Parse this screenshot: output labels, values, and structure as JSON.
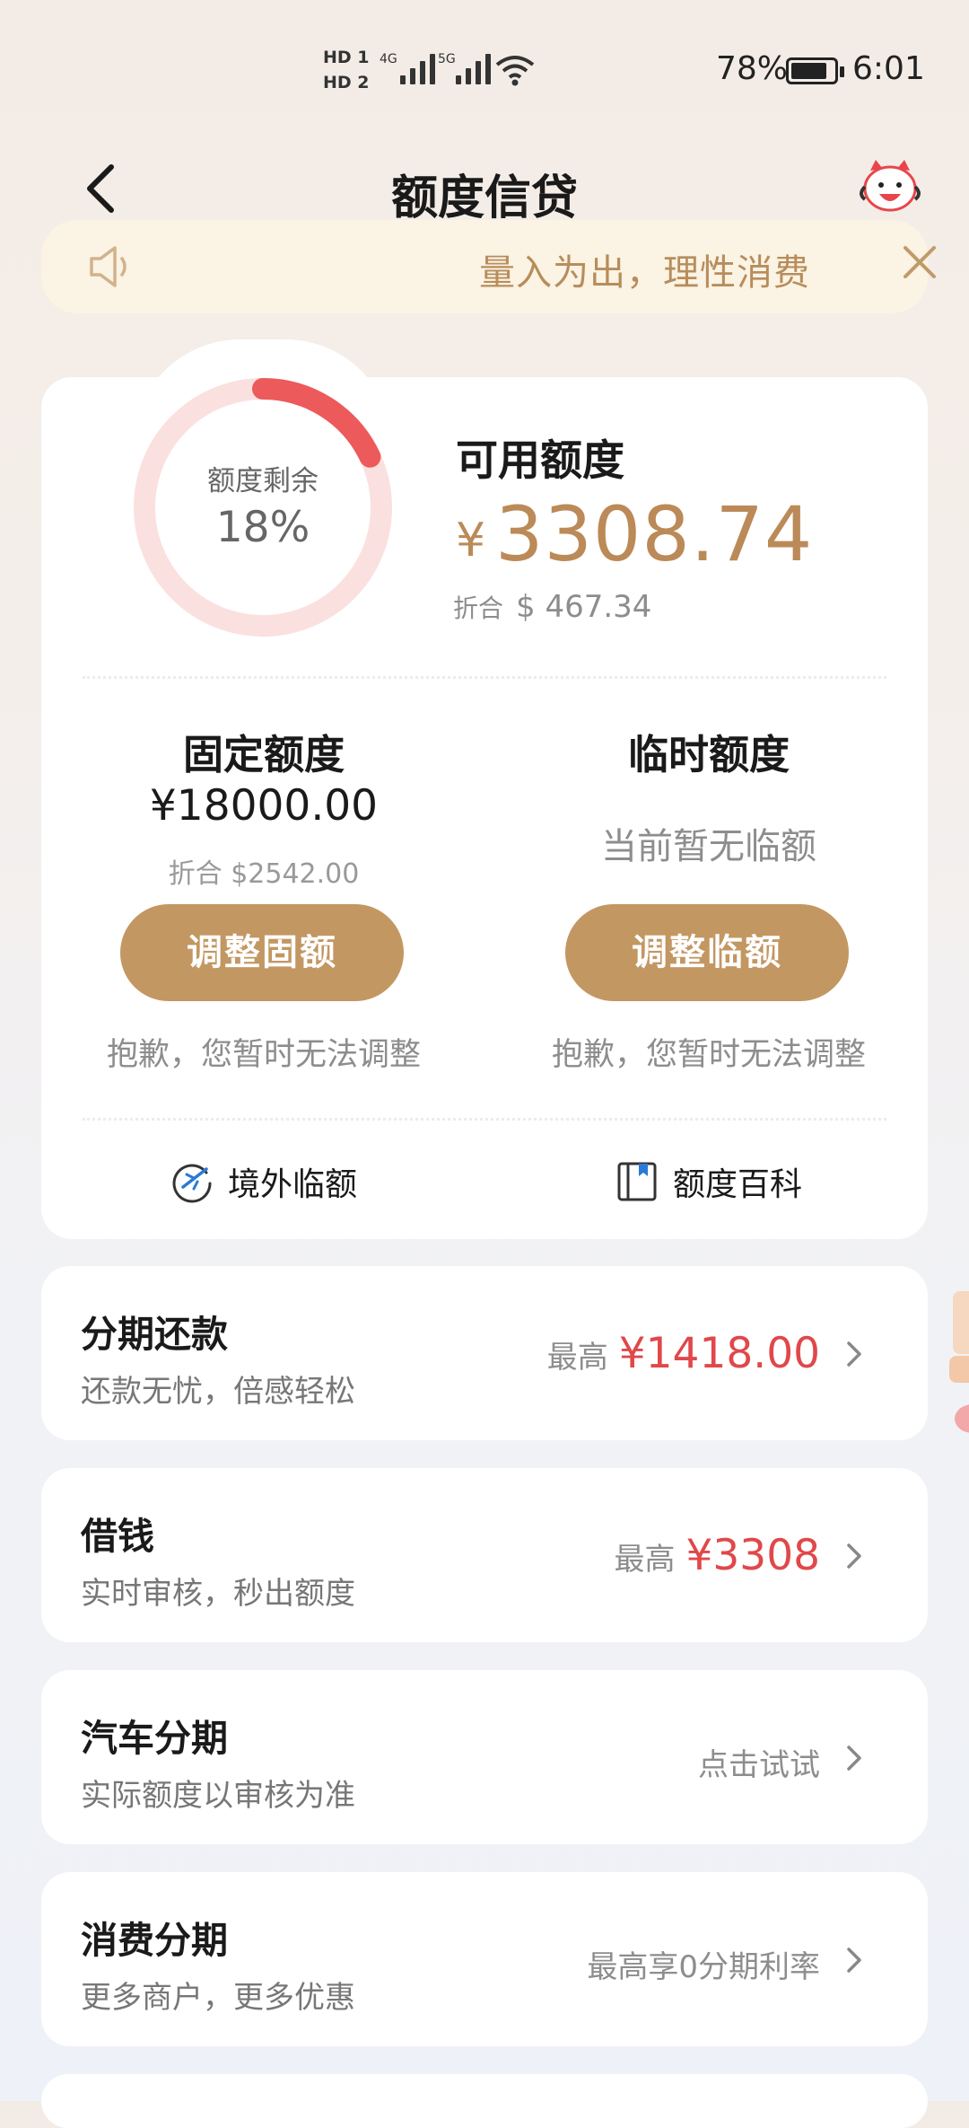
{
  "status_bar": {
    "hd1": "HD 1",
    "hd2": "HD 2",
    "net1": "4G",
    "net2": "5G",
    "battery_pct": "78%",
    "time": "6:01"
  },
  "header": {
    "title": "额度信贷",
    "back_icon": "chevron-left-icon",
    "mascot_icon": "mascot-avatar-icon"
  },
  "notice": {
    "text": "量入为出，理性消费",
    "speaker_icon": "speaker-icon",
    "close_icon": "close-icon"
  },
  "credit": {
    "ring_label": "额度剩余",
    "ring_pct_text": "18%",
    "remaining_fraction": 0.18,
    "available_label": "可用额度",
    "currency": "¥",
    "available_amount": "3308.74",
    "converted_prefix": "折合",
    "converted_amount": "$ 467.34",
    "fixed_title": "固定额度",
    "fixed_amount": "¥18000.00",
    "fixed_converted": "折合 $2542.00",
    "fixed_button": "调整固额",
    "fixed_note": "抱歉，您暂时无法调整",
    "temp_title": "临时额度",
    "temp_none": "当前暂无临额",
    "temp_button": "调整临额",
    "temp_note": "抱歉，您暂时无法调整",
    "overseas_link": "境外临额",
    "wiki_link": "额度百科"
  },
  "colors": {
    "accent_gold": "#c39762",
    "amount_gold": "#bb8a58",
    "ring_red": "#ec5a5b",
    "ring_track": "#fbe0e0",
    "price_red": "#e0484a",
    "notice_bg": "#fbf3e3"
  },
  "list": [
    {
      "title": "分期还款",
      "subtitle": "还款无忧，倍感轻松",
      "prefix": "最高",
      "value": "¥1418.00"
    },
    {
      "title": "借钱",
      "subtitle": "实时审核，秒出额度",
      "prefix": "最高",
      "value": "¥3308"
    },
    {
      "title": "汽车分期",
      "subtitle": "实际额度以审核为准",
      "text": "点击试试"
    },
    {
      "title": "消费分期",
      "subtitle": "更多商户，更多优惠",
      "text": "最高享0分期利率"
    }
  ]
}
